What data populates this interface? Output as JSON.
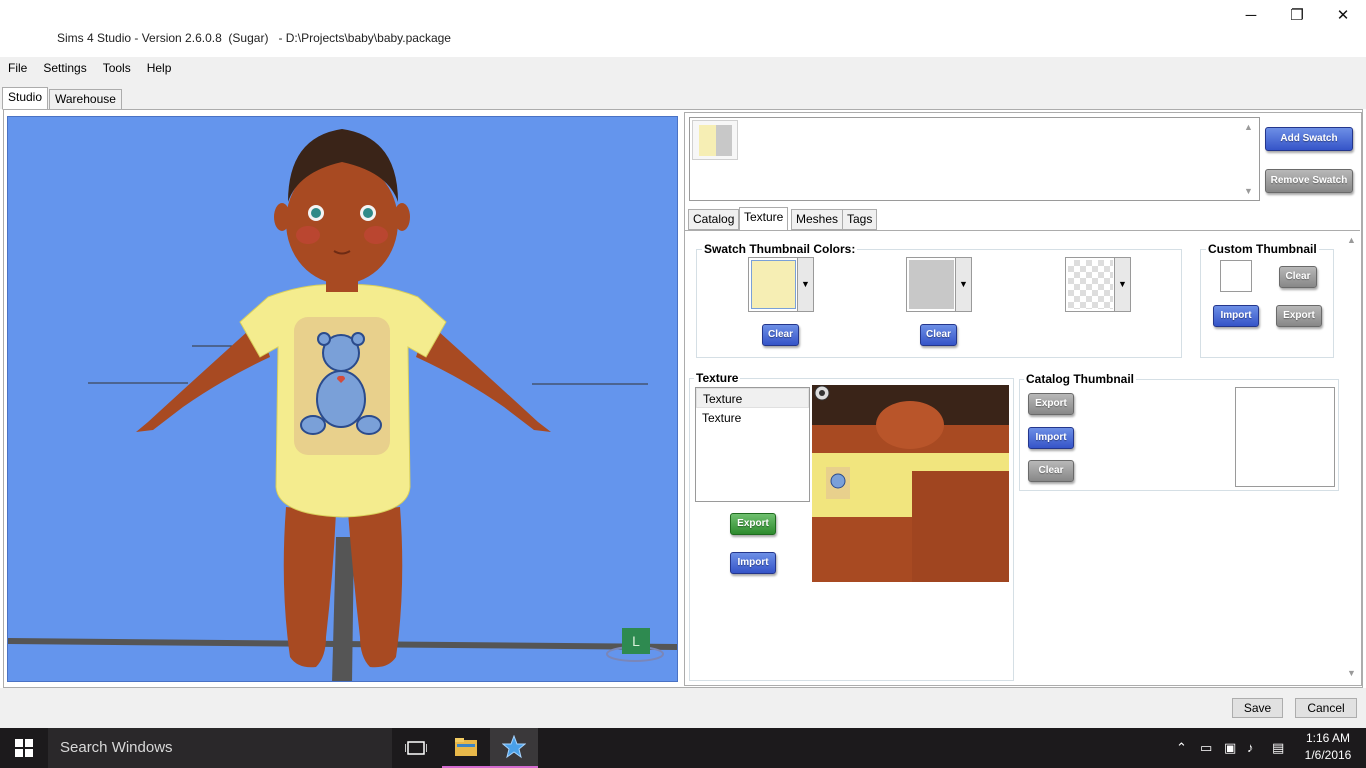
{
  "window": {
    "title": "Sims 4 Studio - Version 2.6.0.8  (Sugar)   - D:\\Projects\\baby\\baby.package",
    "minimize": "─",
    "maximize": "❐",
    "close": "✕"
  },
  "menu": {
    "items": [
      "File",
      "Settings",
      "Tools",
      "Help"
    ]
  },
  "main_tabs": [
    "Studio",
    "Warehouse"
  ],
  "swatch": {
    "add_label": "Add Swatch",
    "remove_label": "Remove Swatch"
  },
  "sub_tabs": [
    "Catalog",
    "Texture",
    "Meshes",
    "Tags"
  ],
  "swatch_colors": {
    "label": "Swatch Thumbnail Colors:",
    "clear_label": "Clear",
    "colors": [
      "#f6eeb4",
      "#c8c8c8"
    ]
  },
  "custom_thumbnail": {
    "label": "Custom Thumbnail",
    "clear_label": "Clear",
    "import_label": "Import",
    "export_label": "Export"
  },
  "texture": {
    "label": "Texture",
    "items": [
      "Texture",
      "Texture"
    ],
    "export_label": "Export",
    "import_label": "Import"
  },
  "catalog_thumbnail": {
    "label": "Catalog Thumbnail",
    "export_label": "Export",
    "import_label": "Import",
    "clear_label": "Clear"
  },
  "viewport": {
    "badge": "L",
    "background": "#6495ed"
  },
  "footer": {
    "save_label": "Save",
    "cancel_label": "Cancel"
  },
  "taskbar": {
    "search_placeholder": "Search Windows",
    "time": "1:16 AM",
    "date": "1/6/2016"
  }
}
